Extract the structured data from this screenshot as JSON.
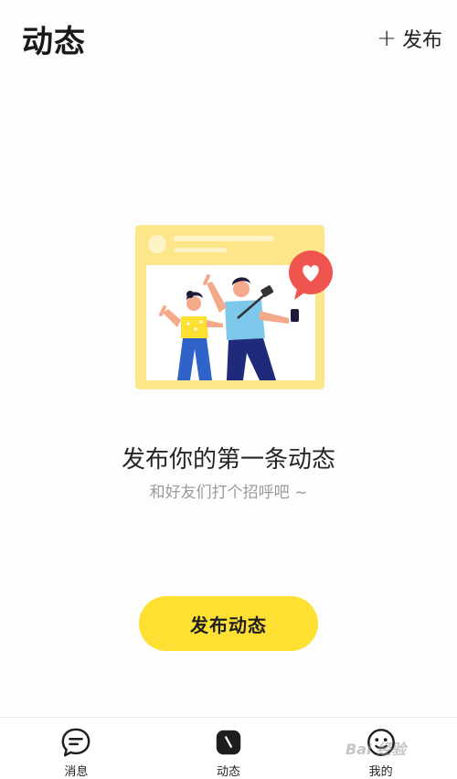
{
  "header": {
    "title": "动态",
    "publish_label": "发布",
    "publish_icon": "plus-icon"
  },
  "empty_state": {
    "illustration": "selfie-couple-illustration",
    "title": "发布你的第一条动态",
    "subtitle": "和好友们打个招呼吧 ~"
  },
  "cta": {
    "label": "发布动态"
  },
  "tabbar": {
    "items": [
      {
        "label": "消息",
        "icon": "chat-bubble-icon"
      },
      {
        "label": "动态",
        "icon": "moments-icon",
        "active": true
      },
      {
        "label": "我的",
        "icon": "face-icon"
      }
    ]
  },
  "watermark": "Bai 经验",
  "colors": {
    "accent_yellow": "#fde032",
    "illustration_frame": "#fde68a",
    "heart_red": "#f0544f",
    "text_primary": "#222222",
    "text_secondary": "#9a9a9a"
  }
}
